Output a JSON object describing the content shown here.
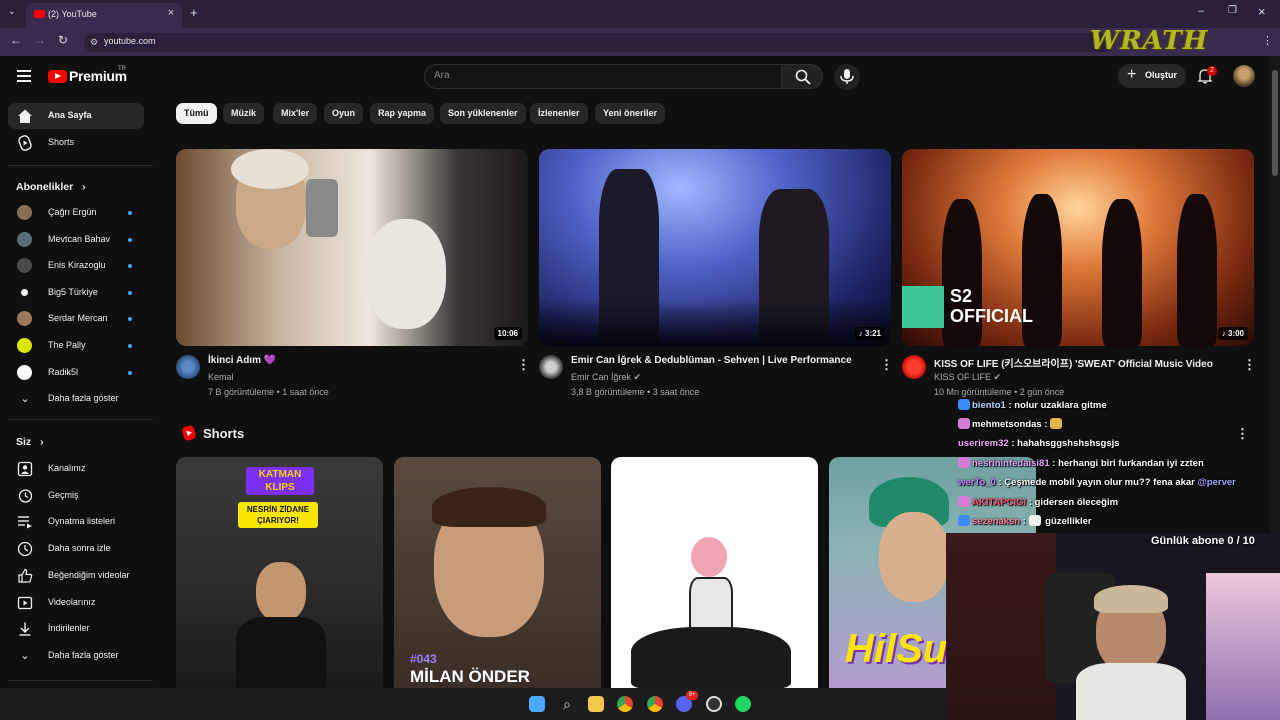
{
  "browser": {
    "tab_title": "(2) YouTube",
    "url": "youtube.com",
    "overlay_brand": "WRATH"
  },
  "header": {
    "logo_text": "Premium",
    "logo_region": "TR",
    "search_placeholder": "Ara",
    "create_label": "Oluştur",
    "notification_count": "2"
  },
  "sidebar": {
    "main": [
      {
        "label": "Ana Sayfa",
        "icon": "home-icon"
      },
      {
        "label": "Shorts",
        "icon": "shorts-icon"
      }
    ],
    "subscriptions_heading": "Abonelikler",
    "subscriptions": [
      {
        "label": "Çağrı Ergün",
        "color": "#8a6e52"
      },
      {
        "label": "Mevtcan Bahav",
        "color": "#5a6e7a"
      },
      {
        "label": "Enis Kirazoglu",
        "color": "#4a4a4a"
      },
      {
        "label": "Big5 Türkiye",
        "color": "#ffffff"
      },
      {
        "label": "Serdar Mercan",
        "color": "#9a7a5a"
      },
      {
        "label": "The Pally",
        "color": "#d8e600"
      },
      {
        "label": "Radik5l",
        "color": "#ffffff"
      }
    ],
    "more_subs_label": "Daha fazla göster",
    "you_heading": "Siz",
    "you_items": [
      {
        "label": "Kanalınız",
        "icon": "channel-icon"
      },
      {
        "label": "Geçmiş",
        "icon": "history-icon"
      },
      {
        "label": "Oynatma listeleri",
        "icon": "playlist-icon"
      },
      {
        "label": "Daha sonra izle",
        "icon": "clock-icon"
      },
      {
        "label": "Beğendiğim videolar",
        "icon": "like-icon"
      },
      {
        "label": "Videolarınız",
        "icon": "video-icon"
      },
      {
        "label": "İndirilenler",
        "icon": "download-icon"
      },
      {
        "label": "Daha fazla göster",
        "icon": "chevron-down-icon"
      }
    ]
  },
  "chips": [
    "Tümü",
    "Müzik",
    "Mix'ler",
    "Oyun",
    "Rap yapma",
    "Son yüklenenler",
    "İzlenenler",
    "Yeni öneriler"
  ],
  "videos": [
    {
      "title": "İkinci Adım 💜",
      "channel": "Kemal",
      "views": "7 B görüntüleme",
      "age": "1 saat önce",
      "duration": "10:06",
      "verified": false
    },
    {
      "title": "Emir Can İğrek & Dedublüman - Sehven | Live Performance",
      "channel": "Emir Can İğrek",
      "views": "3,8 B görüntüleme",
      "age": "3 saat önce",
      "duration": "♪ 3:21",
      "verified": true
    },
    {
      "title": "KISS OF LIFE (키스오브라이프) 'SWEAT' Official Music Video",
      "channel": "KISS OF LIFE",
      "views": "10 Mn görüntüleme",
      "age": "2 gün önce",
      "duration": "♪ 3:00",
      "verified": true,
      "badge_line1": "S2",
      "badge_line2": "OFFICIAL"
    }
  ],
  "views_sep": "•",
  "shorts": {
    "title": "Shorts",
    "items": [
      {
        "overlay_top": "KATMAN",
        "overlay_top2": "KLIPS",
        "caption": "NESRİN ZİDANE ÇIARIYOR!"
      },
      {
        "overlay_number": "#043",
        "overlay_name": "MİLAN ÖNDER"
      },
      {},
      {
        "overlay_word": "HilSu"
      }
    ]
  },
  "chat": [
    {
      "name": "biento1",
      "name_color": "#b6d8ff",
      "message": ": nolur uzaklara gitme"
    },
    {
      "name": "mehmetsondas",
      "name_color": "#ffffff",
      "message": ":"
    },
    {
      "name": "userirem32",
      "name_color": "#f3a7ff",
      "message": ": hahahsggshshshsgsjs"
    },
    {
      "name": "nesrininfedaisi81",
      "name_color": "#e5a3f4",
      "message": ": herhangi biri furkandan iyi zzten"
    },
    {
      "name": "werTo_0",
      "name_color": "#c084ff",
      "message": ": Çeşmede mobil yayın olur mu?? fena akar",
      "mention": "@perver"
    },
    {
      "name": "AKITAPCIGI",
      "name_color": "#ff5577",
      "message": ": gidersen öleceğim"
    },
    {
      "name": "sezenaksn",
      "name_color": "#ff7f9a",
      "message": ":",
      "tail": "güzellikler"
    }
  ],
  "sub_goal": "Günlük abone 0 / 10",
  "taskbar_badge": "9+"
}
